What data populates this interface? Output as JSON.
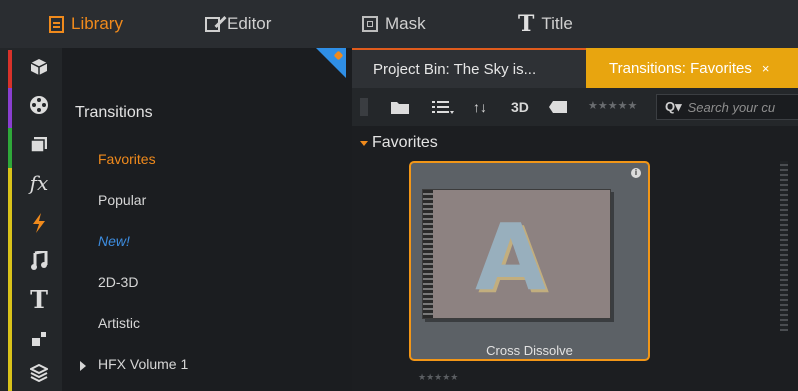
{
  "topbar": {
    "tabs": [
      {
        "label": "Library",
        "icon": "library-icon"
      },
      {
        "label": "Editor",
        "icon": "edit-icon"
      },
      {
        "label": "Mask",
        "icon": "mask-icon"
      },
      {
        "label": "Title",
        "icon": "title-icon"
      }
    ],
    "active": "Library"
  },
  "rail": {
    "icons": [
      "package-icon",
      "film-reel-icon",
      "clips-icon",
      "fx-icon",
      "lightning-icon",
      "music-icon",
      "title-T-icon",
      "montage-icon",
      "layers-icon"
    ],
    "fx_glyph": "fx",
    "title_glyph": "T"
  },
  "categories": {
    "title": "Transitions",
    "items": [
      "Favorites",
      "Popular",
      "New!",
      "2D-3D",
      "Artistic",
      "HFX Volume 1"
    ],
    "active": "Favorites"
  },
  "bin": {
    "tabs": [
      "Project Bin: The Sky is...",
      "Transitions: Favorites"
    ],
    "close_glyph": "×",
    "active_tab": "Transitions: Favorites"
  },
  "toolbar": {
    "sort_glyph": "↑↓",
    "view_3d": "3D",
    "stars": "★★★★★",
    "search_icon_glyph": "Q▾",
    "search_placeholder": "Search your cu"
  },
  "group": {
    "title": "Favorites",
    "items": [
      {
        "label": "Cross Dissolve",
        "thumb_letter": "A",
        "rating": "★★★★★"
      }
    ]
  },
  "colors": {
    "accent": "#f08a1c",
    "tab_active": "#e8a50f",
    "new_label": "#3d8de0"
  }
}
